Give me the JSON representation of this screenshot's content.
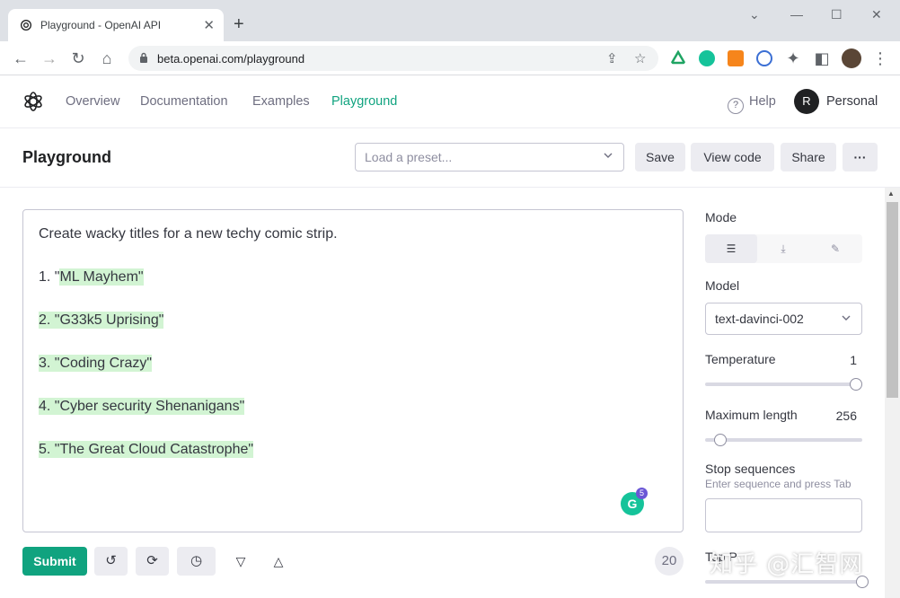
{
  "browser": {
    "tab_title": "Playground - OpenAI API",
    "tab_close": "✕",
    "new_tab": "+",
    "url": "beta.openai.com/playground",
    "window_controls": {
      "minimize": "—",
      "maximize": "☐",
      "close": "✕"
    }
  },
  "nav": {
    "links": [
      "Overview",
      "Documentation",
      "Examples",
      "Playground"
    ],
    "active": "Playground",
    "help": "Help",
    "avatar_initial": "R",
    "account": "Personal"
  },
  "toolbar": {
    "title": "Playground",
    "preset_placeholder": "Load a preset...",
    "save": "Save",
    "view_code": "View code",
    "share": "Share",
    "more": "···"
  },
  "editor": {
    "prompt": "Create wacky titles for a new techy comic strip.",
    "lines": [
      {
        "prefix": "1. \"",
        "text": "ML Mayhem\""
      },
      {
        "prefix": "",
        "text": "2. \"G33k5 Uprising\""
      },
      {
        "prefix": "",
        "text": "3. \"Coding Crazy\""
      },
      {
        "prefix": "",
        "text": "4. \"Cyber security Shenanigans\""
      },
      {
        "prefix": "",
        "text": "5. \"The Great Cloud Catastrophe\""
      }
    ],
    "grammarly_letter": "G",
    "grammarly_count": "5"
  },
  "bottom": {
    "submit": "Submit",
    "token_count": "20"
  },
  "settings": {
    "mode_label": "Mode",
    "model_label": "Model",
    "model_value": "text-davinci-002",
    "temperature_label": "Temperature",
    "temperature_value": "1",
    "temperature_fraction": 1.0,
    "max_length_label": "Maximum length",
    "max_length_value": "256",
    "max_length_fraction": 0.06,
    "stop_label": "Stop sequences",
    "stop_hint": "Enter sequence and press Tab",
    "top_p_label": "Top P"
  },
  "watermark": "知乎 @汇智网",
  "colors": {
    "accent": "#10a37f",
    "highlight": "#d2f4d3",
    "text": "#353740",
    "muted": "#6e6e80"
  }
}
